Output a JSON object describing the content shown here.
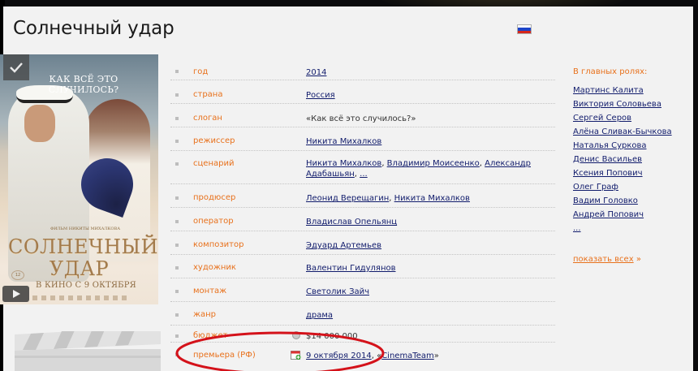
{
  "movie": {
    "title": "Солнечный удар",
    "flag_icon": "russia-flag-icon"
  },
  "poster": {
    "tagline": "КАК ВСЁ ЭТО СЛУЧИЛОСЬ?",
    "credit": "ФИЛЬМ НИКИТЫ МИХАЛКОВА",
    "title_line1": "СОЛНЕЧНЫЙ",
    "title_line2": "УДАР",
    "release": "В КИНО С 9 ОКТЯБРЯ",
    "age": "12",
    "check_icon": "checkmark-icon",
    "play_icon": "play-icon"
  },
  "info": {
    "year": {
      "label": "год",
      "value": "2014"
    },
    "country": {
      "label": "страна",
      "value": "Россия"
    },
    "slogan": {
      "label": "слоган",
      "value": "«Как всё это случилось?»"
    },
    "director": {
      "label": "режиссер",
      "value": "Никита Михалков"
    },
    "writers": {
      "label": "сценарий",
      "names": [
        "Никита Михалков",
        "Владимир Моисеенко",
        "Александр Адабашьян"
      ],
      "more": "..."
    },
    "producers": {
      "label": "продюсер",
      "names": [
        "Леонид Верещагин",
        "Никита Михалков"
      ]
    },
    "operator": {
      "label": "оператор",
      "value": "Владислав Опельянц"
    },
    "composer": {
      "label": "композитор",
      "value": "Эдуард Артемьев"
    },
    "artist": {
      "label": "художник",
      "value": "Валентин Гидулянов"
    },
    "editing": {
      "label": "монтаж",
      "value": "Светолик Зайч"
    },
    "genre": {
      "label": "жанр",
      "value": "драма"
    },
    "budget": {
      "label": "бюджет",
      "value": "$14 000 000"
    },
    "premiere": {
      "label": "премьера (РФ)",
      "date": "9 октября 2014",
      "distributor_prefix": "«",
      "distributor": "CinemaTeam",
      "distributor_suffix": "»"
    }
  },
  "cast": {
    "title": "В главных ролях:",
    "actors": [
      "Мартинс Калита",
      "Виктория Соловьева",
      "Сергей Серов",
      "Алёна Сливак-Бычкова",
      "Наталья Суркова",
      "Денис Васильев",
      "Ксения Попович",
      "Олег Граф",
      "Вадим Головко",
      "Андрей Попович"
    ],
    "more": "...",
    "show_all": "показать всех",
    "show_all_arrow": "»"
  },
  "colors": {
    "accent_orange": "#e8711c",
    "link_blue": "#111c6c",
    "highlight_red": "#d4121a"
  }
}
